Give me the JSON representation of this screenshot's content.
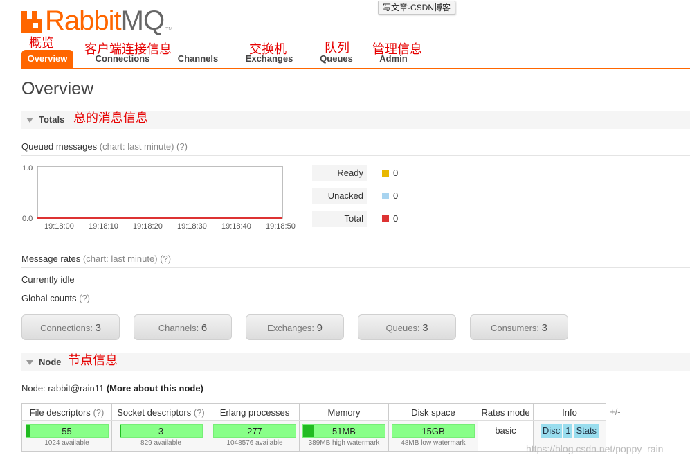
{
  "tooltip": "写文章-CSDN博客",
  "logo": {
    "rabbit": "Rabbit",
    "mq": "MQ",
    "tm": "TM"
  },
  "annotations": {
    "overview": "概览",
    "connections": "客户端连接信息",
    "exchanges": "交换机",
    "queues": "队列",
    "admin": "管理信息",
    "totals": "总的消息信息",
    "node": "节点信息"
  },
  "tabs": [
    {
      "label": "Overview",
      "active": true
    },
    {
      "label": "Connections"
    },
    {
      "label": "Channels"
    },
    {
      "label": "Exchanges"
    },
    {
      "label": "Queues"
    },
    {
      "label": "Admin"
    }
  ],
  "page_title": "Overview",
  "totals": {
    "label": "Totals",
    "queued_label": "Queued messages",
    "queued_hint": "(chart: last minute) (?)",
    "chart": {
      "y_ticks": [
        "1.0",
        "0.0"
      ],
      "x_ticks": [
        "19:18:00",
        "19:18:10",
        "19:18:20",
        "19:18:30",
        "19:18:40",
        "19:18:50"
      ]
    },
    "legend": [
      {
        "label": "Ready",
        "value": "0",
        "color": "#e8b800"
      },
      {
        "label": "Unacked",
        "value": "0",
        "color": "#a8d4f0"
      },
      {
        "label": "Total",
        "value": "0",
        "color": "#dd3333"
      }
    ],
    "rates_label": "Message rates",
    "rates_hint": "(chart: last minute) (?)",
    "idle": "Currently idle",
    "global_label": "Global counts",
    "global_hint": "(?)"
  },
  "global_counts": [
    {
      "label": "Connections:",
      "value": "3"
    },
    {
      "label": "Channels:",
      "value": "6"
    },
    {
      "label": "Exchanges:",
      "value": "9"
    },
    {
      "label": "Queues:",
      "value": "3"
    },
    {
      "label": "Consumers:",
      "value": "3"
    }
  ],
  "node": {
    "label": "Node",
    "prefix": "Node: rabbit@rain11",
    "more": "(More about this node)",
    "headers": {
      "fd": "File descriptors",
      "fd_hint": "(?)",
      "sd": "Socket descriptors",
      "sd_hint": "(?)",
      "ep": "Erlang processes",
      "mem": "Memory",
      "disk": "Disk space",
      "rates": "Rates mode",
      "info": "Info"
    },
    "values": {
      "fd": "55",
      "fd_sub": "1024 available",
      "sd": "3",
      "sd_sub": "829 available",
      "ep": "277",
      "ep_sub": "1048576 available",
      "mem": "51MB",
      "mem_sub": "389MB high watermark",
      "disk": "15GB",
      "disk_sub": "48MB low watermark",
      "rates": "basic",
      "info": [
        "Disc",
        "1",
        "Stats"
      ]
    },
    "plusminus": "+/-"
  },
  "watermark": "https://blog.csdn.net/poppy_rain",
  "colors": {
    "brand": "#ff6600",
    "bar_green": "#88ff88",
    "annotation_red": "#e60000"
  }
}
